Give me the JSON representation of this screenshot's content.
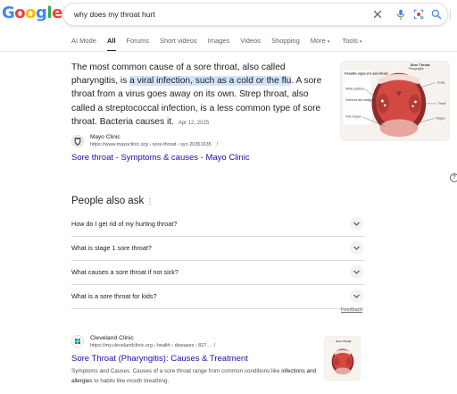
{
  "header": {
    "logo_letters": [
      "G",
      "o",
      "o",
      "g",
      "l",
      "e"
    ],
    "logo_colors": [
      "#4285F4",
      "#EA4335",
      "#FBBC05",
      "#4285F4",
      "#34A853",
      "#EA4335"
    ],
    "search_query": "why does my throat hurt",
    "icons": [
      "close-icon",
      "voice-search-icon",
      "image-search-icon",
      "search-icon"
    ]
  },
  "tabs": [
    {
      "label": "AI Mode",
      "active": false
    },
    {
      "label": "All",
      "active": true
    },
    {
      "label": "Forums",
      "active": false
    },
    {
      "label": "Short videos",
      "active": false
    },
    {
      "label": "Images",
      "active": false
    },
    {
      "label": "Videos",
      "active": false
    },
    {
      "label": "Shopping",
      "active": false
    },
    {
      "label": "More",
      "active": false,
      "caret": "▾"
    },
    {
      "label": "Tools",
      "active": false,
      "caret": "▾"
    }
  ],
  "featured_snippet": {
    "text_before": "The most common cause of a sore throat, also called pharyngitis, is ",
    "highlight": "a viral infection, such as a cold or the flu",
    "text_after": ". A sore throat from a virus goes away on its own. Strep throat, also called a streptococcal infection, is a less common type of sore throat. Bacteria causes it.",
    "date": "Apr 12, 2025",
    "image_labels": {
      "title": "Sore Throat",
      "subtitle": "Pharyngitis",
      "box_title": "Possible signs of a sore throat",
      "white_patches": "White patches",
      "redness": "Redness and swelling",
      "pale_tongue": "Pale tongue",
      "uvula": "Uvula",
      "tonsil": "Tonsil",
      "tongue": "Tongue"
    }
  },
  "source": {
    "name": "Mayo Clinic",
    "url": "https://www.mayoclinic.org › sore-throat › syc-20351635",
    "link_title": "Sore throat - Symptoms & causes - Mayo Clinic"
  },
  "paa": {
    "title": "People also ask",
    "questions": [
      "How do I get rid of my hurting throat?",
      "What is stage 1 sore throat?",
      "What causes a sore throat if not sick?",
      "What is a sore throat for kids?"
    ],
    "feedback": "Feedback"
  },
  "result2": {
    "source_name": "Cleveland Clinic",
    "url": "https://my.clevelandclinic.org › health › diseases › 827...",
    "title": "Sore Throat (Pharyngitis): Causes & Treatment",
    "desc_start": "Symptoms and Causes. Causes of a sore throat range from common conditions like ",
    "desc_bold": "infections and allergies",
    "desc_end": " to habits like mouth breathing.",
    "thumb_title": "Sore Throat"
  },
  "colors": {
    "link": "#1a0dab",
    "highlight": "#d3e3fd",
    "throat_red": "#c8403a"
  }
}
